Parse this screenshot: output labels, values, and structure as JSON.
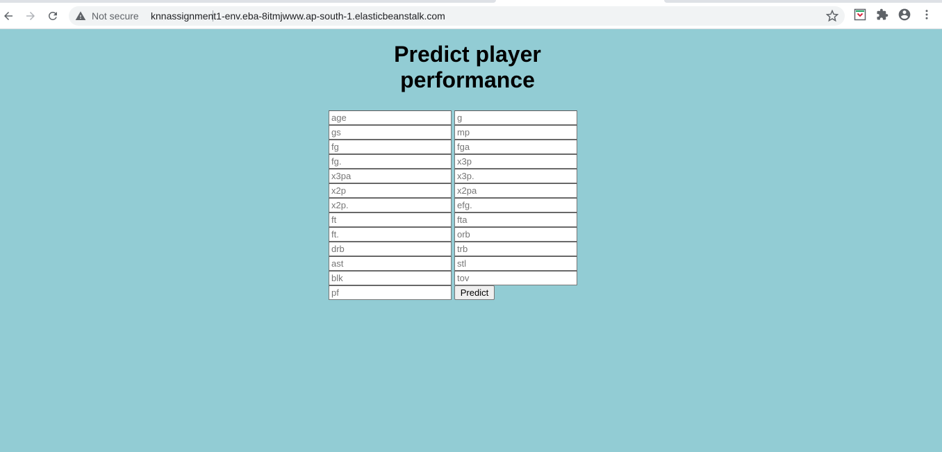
{
  "browser": {
    "security_label": "Not secure",
    "url": "knnassignment1-env.eba-8itmjwww.ap-south-1.elasticbeanstalk.com",
    "icons": [
      "back-arrow-icon",
      "forward-arrow-icon",
      "reload-icon",
      "warning-icon",
      "star-icon",
      "pocket-extension-icon",
      "puzzle-extensions-icon",
      "account-icon",
      "more-vert-icon"
    ]
  },
  "page": {
    "title_line1": "Predict player",
    "title_line2": "performance",
    "background_color": "#92ccd4"
  },
  "form": {
    "fields": [
      {
        "placeholder": "age",
        "value": ""
      },
      {
        "placeholder": "g",
        "value": ""
      },
      {
        "placeholder": "gs",
        "value": ""
      },
      {
        "placeholder": "mp",
        "value": ""
      },
      {
        "placeholder": "fg",
        "value": ""
      },
      {
        "placeholder": "fga",
        "value": ""
      },
      {
        "placeholder": "fg.",
        "value": ""
      },
      {
        "placeholder": "x3p",
        "value": ""
      },
      {
        "placeholder": "x3pa",
        "value": ""
      },
      {
        "placeholder": "x3p.",
        "value": ""
      },
      {
        "placeholder": "x2p",
        "value": ""
      },
      {
        "placeholder": "x2pa",
        "value": ""
      },
      {
        "placeholder": "x2p.",
        "value": ""
      },
      {
        "placeholder": "efg.",
        "value": ""
      },
      {
        "placeholder": "ft",
        "value": ""
      },
      {
        "placeholder": "fta",
        "value": ""
      },
      {
        "placeholder": "ft.",
        "value": ""
      },
      {
        "placeholder": "orb",
        "value": ""
      },
      {
        "placeholder": "drb",
        "value": ""
      },
      {
        "placeholder": "trb",
        "value": ""
      },
      {
        "placeholder": "ast",
        "value": ""
      },
      {
        "placeholder": "stl",
        "value": ""
      },
      {
        "placeholder": "blk",
        "value": ""
      },
      {
        "placeholder": "tov",
        "value": ""
      },
      {
        "placeholder": "pf",
        "value": ""
      }
    ],
    "submit_label": "Predict"
  }
}
